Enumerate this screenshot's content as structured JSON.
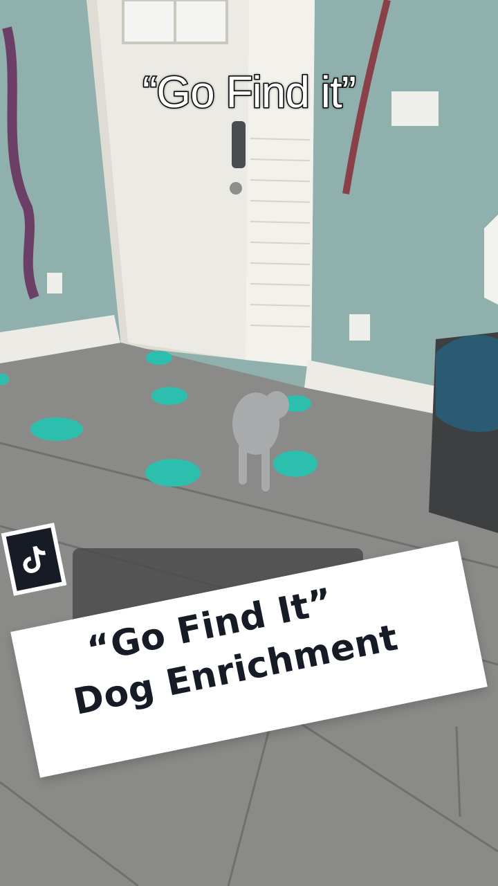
{
  "video": {
    "caption": "“Go Find it”"
  },
  "card": {
    "title_line1": "“Go Find It”",
    "title_line2": "Dog Enrichment"
  },
  "icons": {
    "badge": "tiktok-logo-icon"
  },
  "colors": {
    "wall": "#8fb0ac",
    "floor": "#8a8b88",
    "door": "#e9e8e2",
    "cone": "#2cbfae",
    "card_bg": "#ffffff",
    "card_text": "#161b26"
  }
}
